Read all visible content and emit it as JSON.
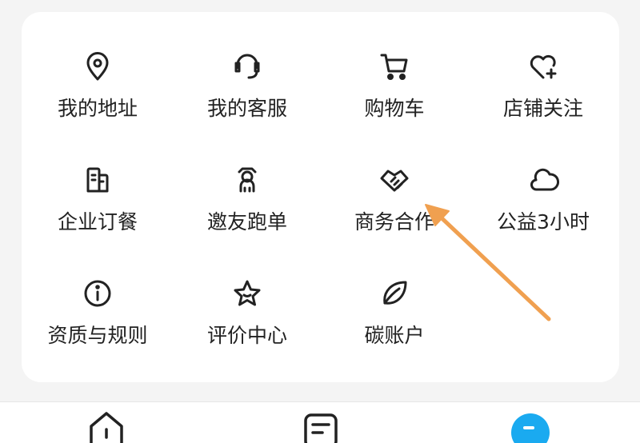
{
  "services": [
    {
      "label": "我的地址",
      "icon": "location-pin-icon"
    },
    {
      "label": "我的客服",
      "icon": "headset-icon"
    },
    {
      "label": "购物车",
      "icon": "shopping-cart-icon"
    },
    {
      "label": "店铺关注",
      "icon": "heart-plus-icon"
    },
    {
      "label": "企业订餐",
      "icon": "building-icon"
    },
    {
      "label": "邀友跑单",
      "icon": "rider-icon"
    },
    {
      "label": "商务合作",
      "icon": "handshake-icon"
    },
    {
      "label": "公益3小时",
      "icon": "cloud-icon"
    },
    {
      "label": "资质与规则",
      "icon": "info-icon"
    },
    {
      "label": "评价中心",
      "icon": "star-icon"
    },
    {
      "label": "碳账户",
      "icon": "leaf-icon"
    }
  ],
  "tabbar": [
    {
      "icon": "home-icon"
    },
    {
      "icon": "order-icon"
    },
    {
      "icon": "profile-icon",
      "active_color": "#1aaaf0"
    }
  ],
  "annotation": {
    "arrow_color": "#f0a050",
    "target": "商务合作"
  }
}
